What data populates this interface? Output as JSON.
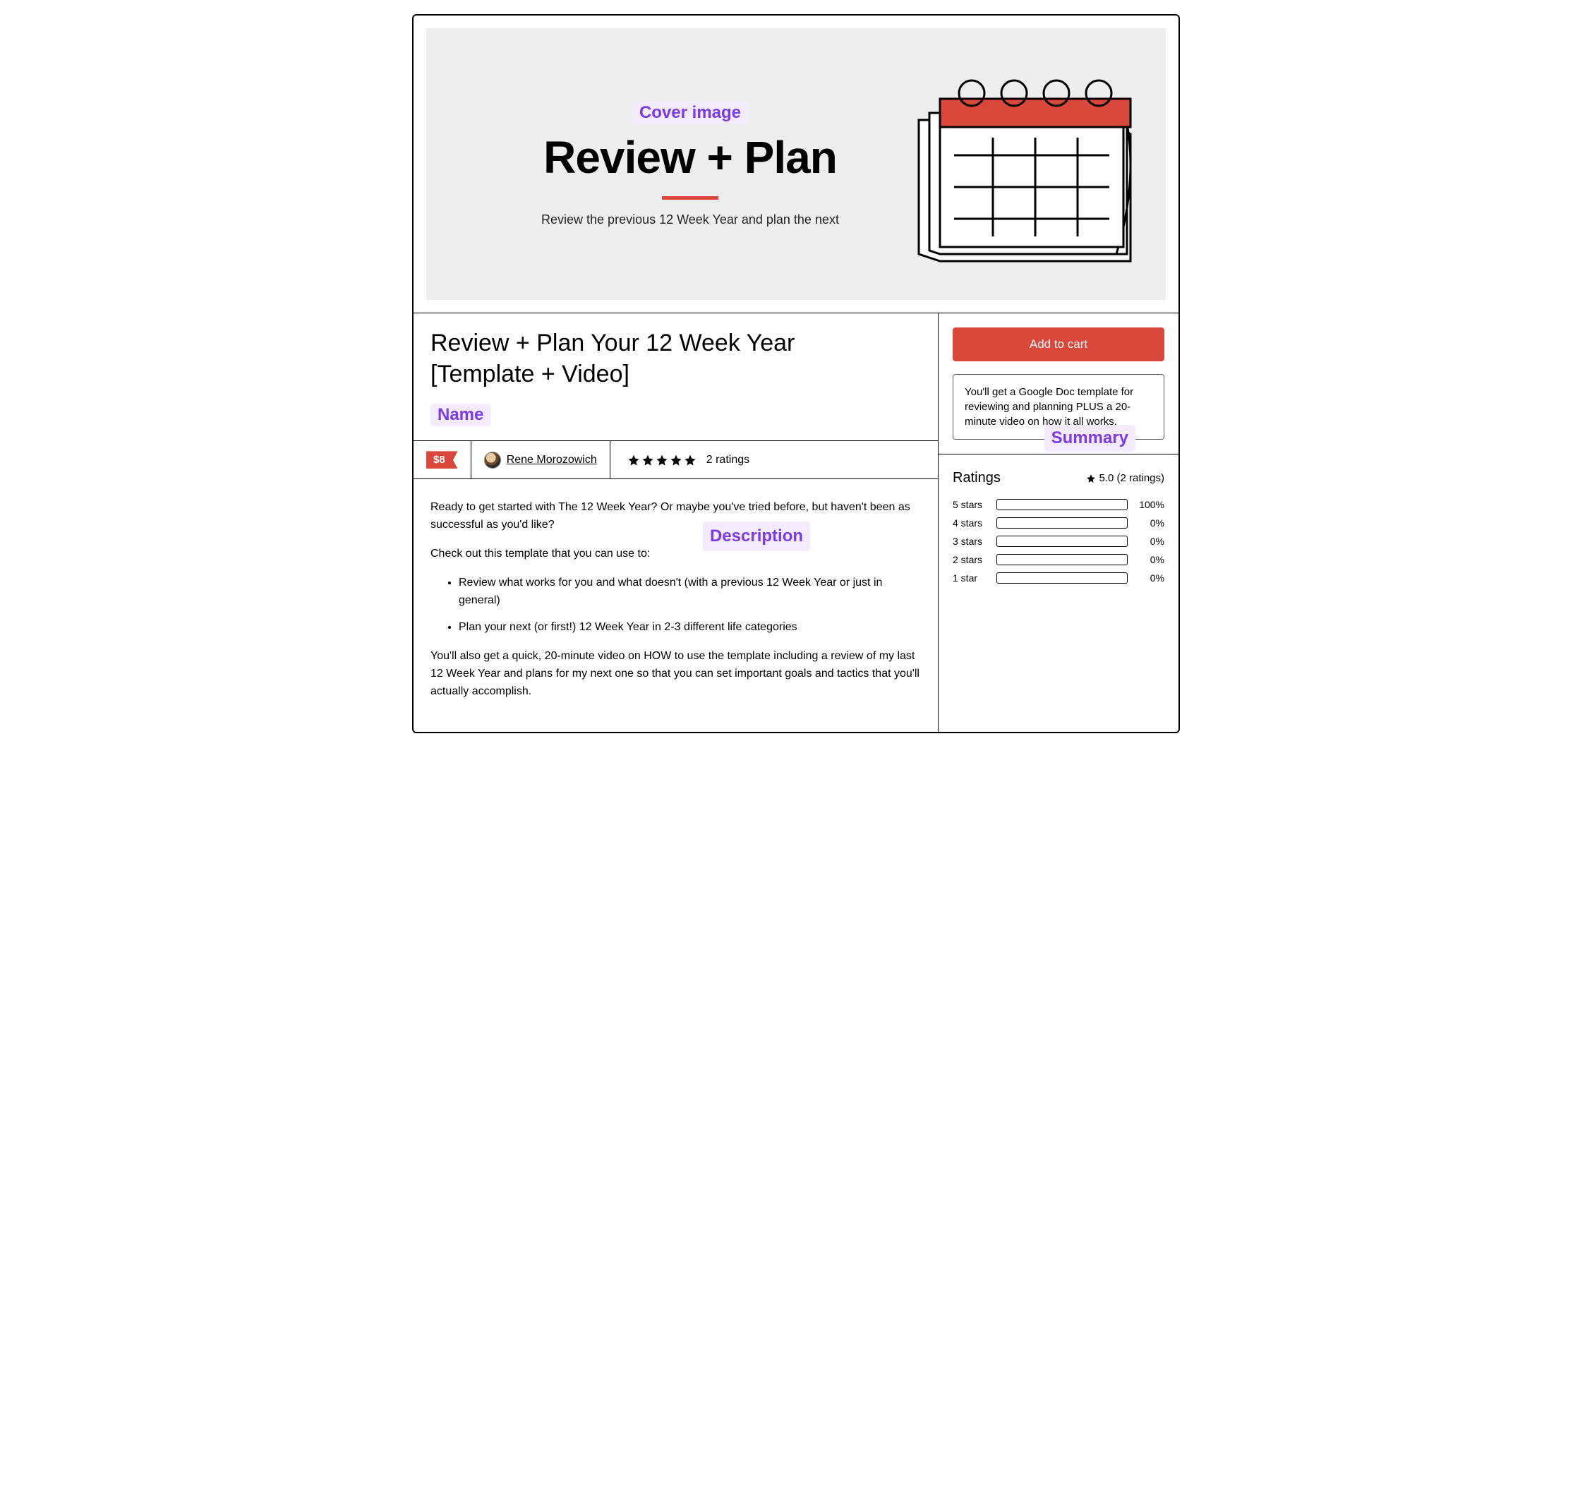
{
  "annotations": {
    "cover": "Cover image",
    "name": "Name",
    "description": "Description",
    "summary": "Summary"
  },
  "cover": {
    "title": "Review + Plan",
    "subtitle": "Review the previous 12 Week Year and plan the next"
  },
  "product": {
    "title": "Review + Plan Your 12 Week Year [Template + Video]",
    "price": "$8",
    "author": "Rene Morozowich",
    "ratings_count_label": "2 ratings"
  },
  "description": {
    "p1": "Ready to get started with The 12 Week Year? Or maybe you've tried before, but haven't been as successful as you'd like?",
    "p2": "Check out this template that you can use to:",
    "bullets": [
      "Review what works for you and what doesn't (with a previous 12 Week Year or just in general)",
      "Plan your next (or first!) 12 Week Year in 2-3 different life categories"
    ],
    "p3": "You'll also get a quick, 20-minute video on HOW to use the template including a review of my last 12 Week Year and plans for my next one so that you can set important goals and tactics that you'll actually accomplish."
  },
  "cta": {
    "button": "Add to cart",
    "summary": "You'll get a Google Doc template for reviewing and planning PLUS a 20-minute video on how it all works."
  },
  "ratings": {
    "title": "Ratings",
    "score_label": "5.0 (2 ratings)",
    "rows": [
      {
        "label": "5 stars",
        "pct": 100,
        "pct_label": "100%"
      },
      {
        "label": "4 stars",
        "pct": 0,
        "pct_label": "0%"
      },
      {
        "label": "3 stars",
        "pct": 0,
        "pct_label": "0%"
      },
      {
        "label": "2 stars",
        "pct": 0,
        "pct_label": "0%"
      },
      {
        "label": "1 star",
        "pct": 0,
        "pct_label": "0%"
      }
    ]
  }
}
